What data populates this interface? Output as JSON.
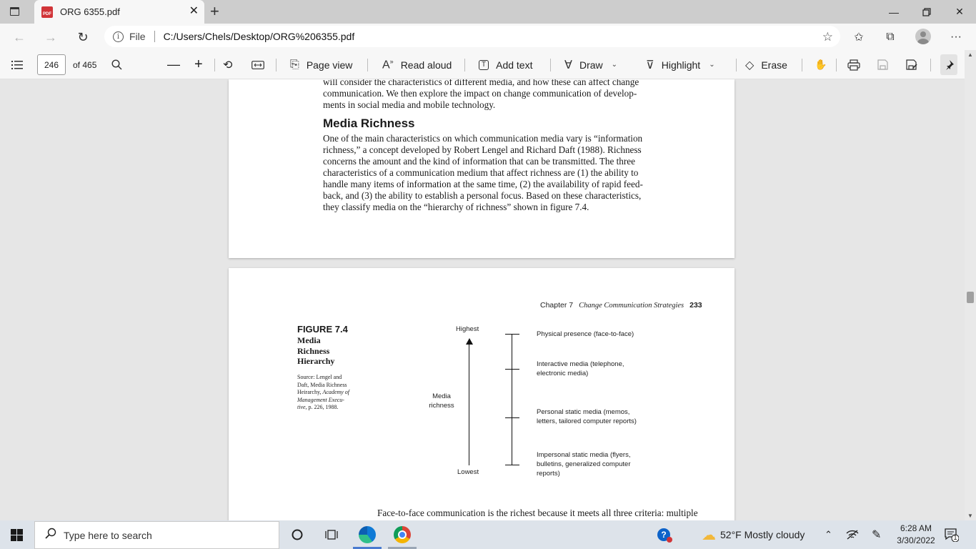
{
  "browser": {
    "tab_title": "ORG 6355.pdf",
    "file_label": "File",
    "url": "C:/Users/Chels/Desktop/ORG%206355.pdf"
  },
  "pdf_toolbar": {
    "page_number": "246",
    "page_total": "of 465",
    "page_view_label": "Page view",
    "read_aloud_label": "Read aloud",
    "add_text_label": "Add text",
    "draw_label": "Draw",
    "highlight_label": "Highlight",
    "erase_label": "Erase"
  },
  "page1": {
    "top_lines": [
      "will consider the characteristics of different media, and how these can affect change",
      "communication. We then explore the impact on change communication of develop-",
      "ments in social media and mobile technology."
    ],
    "heading": "Media Richness",
    "body_lines": [
      "One of the main characteristics on which communication media vary is “information",
      "richness,” a concept developed by Robert Lengel and Richard Daft (1988). Richness",
      "concerns the amount and the kind of information that can be transmitted. The three",
      "characteristics of a communication medium that affect richness are (1) the ability to",
      "handle many items of information at the same time, (2) the availability of rapid feed-",
      "back, and (3) the ability to establish a personal focus. Based on these characteristics,",
      "they classify media on the “hierarchy of richness” shown in figure 7.4."
    ]
  },
  "page2": {
    "running_head_chapter": "Chapter 7",
    "running_head_title": "Change Communication Strategies",
    "page_number": "233",
    "figure_number": "FIGURE 7.4",
    "figure_title_lines": [
      "Media",
      "Richness",
      "Hierarchy"
    ],
    "source_lines": [
      "Source: Lengel and",
      "Daft, Media Richness",
      "Heirarchy,"
    ],
    "source_italic_lines": [
      "Academy of",
      "Management Execu-",
      "tive,"
    ],
    "source_tail": "p. 226, 1988.",
    "axis_top": "Highest",
    "axis_bottom": "Lowest",
    "axis_label_lines": [
      "Media",
      "richness"
    ],
    "levels": [
      {
        "lines": [
          "Physical presence (face-to-face)"
        ]
      },
      {
        "lines": [
          "Interactive media (telephone,",
          "electronic media)"
        ]
      },
      {
        "lines": [
          "Personal static media (memos,",
          "letters, tailored computer reports)"
        ]
      },
      {
        "lines": [
          "Impersonal static media (flyers,",
          "bulletins, generalized computer",
          "reports)"
        ]
      }
    ],
    "bottom_text": "Face-to-face communication is the richest because it meets all three criteria: multiple"
  },
  "taskbar": {
    "search_placeholder": "Type here to search",
    "weather": "52°F  Mostly cloudy",
    "time": "6:28 AM",
    "date": "3/30/2022",
    "notification_count": "1"
  }
}
